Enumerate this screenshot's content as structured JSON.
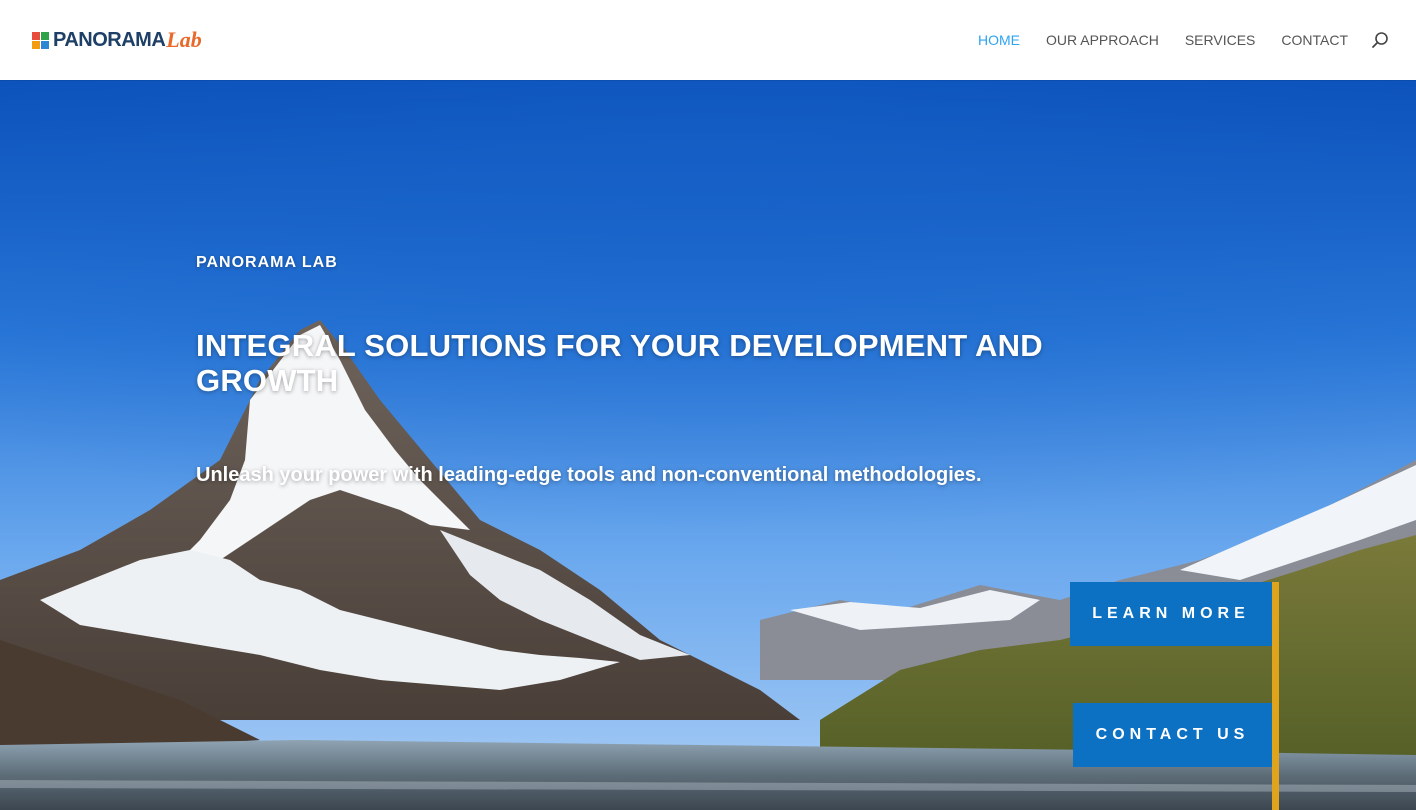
{
  "brand": {
    "name_part1": "PANORAMA",
    "name_part2": "Lab",
    "colors": [
      "#e84c3d",
      "#2ea34a",
      "#f39c12",
      "#2d86d4"
    ],
    "text_color": "#1e3f66",
    "accent_color": "#e8692a"
  },
  "nav": {
    "items": [
      {
        "label": "HOME",
        "active": true
      },
      {
        "label": "OUR APPROACH",
        "active": false
      },
      {
        "label": "SERVICES",
        "active": false
      },
      {
        "label": "CONTACT",
        "active": false
      }
    ],
    "search_icon": "search-icon",
    "active_color": "#2ea3f2"
  },
  "hero": {
    "eyebrow": "PANORAMA LAB",
    "headline": "INTEGRAL SOLUTIONS FOR YOUR DEVELOPMENT AND GROWTH",
    "subline": "Unleash your power with leading-edge tools and non-conventional methodologies.",
    "buttons": {
      "learn_more": "LEARN MORE",
      "contact_us": "CONTACT US"
    },
    "button_color": "#0c71c3",
    "accent_color": "#e0a31c"
  }
}
